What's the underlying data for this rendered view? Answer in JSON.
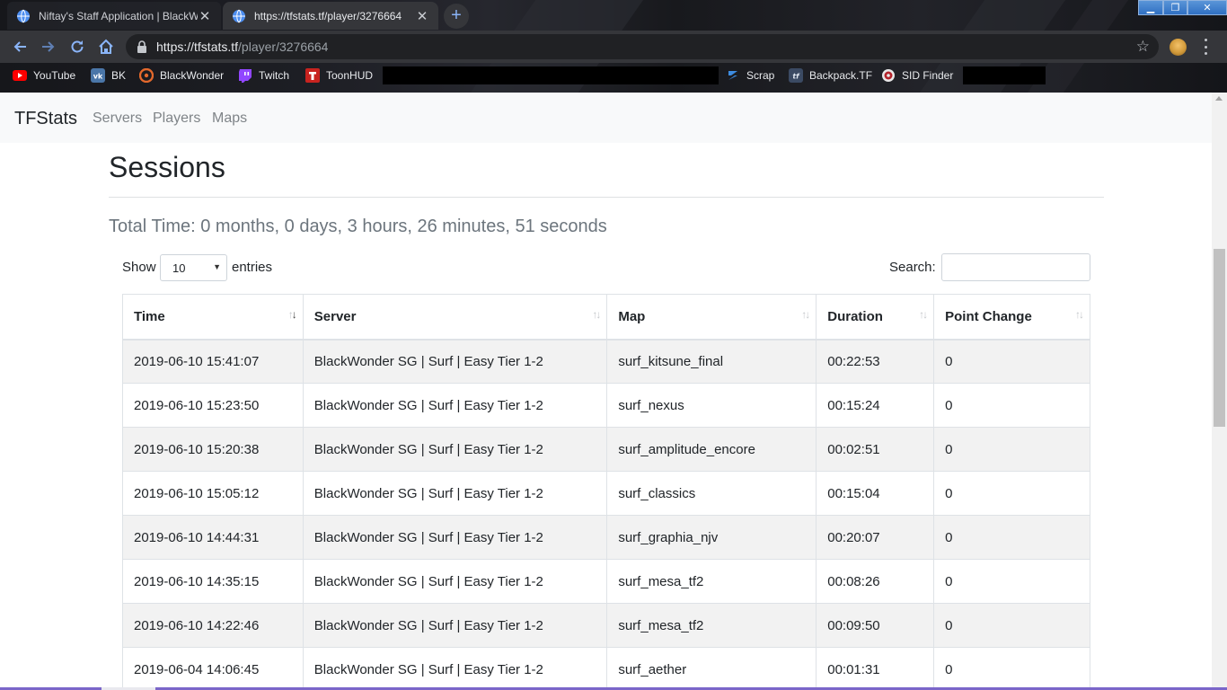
{
  "browser": {
    "tabs": [
      {
        "title": "Niftay's Staff Application | BlackWonder",
        "active": false
      },
      {
        "title": "https://tfstats.tf/player/3276664",
        "active": true
      }
    ],
    "new_tab_label": "+",
    "url_host": "https://tfstats.tf",
    "url_path": "/player/3276664",
    "window_controls": {
      "minimize": "▁",
      "maximize": "❐",
      "close": "✕"
    },
    "bookmarks": [
      {
        "label": "YouTube",
        "icon": "youtube-icon"
      },
      {
        "label": "BK",
        "icon": "vk-icon"
      },
      {
        "label": "BlackWonder",
        "icon": "blackwonder-icon"
      },
      {
        "label": "Twitch",
        "icon": "twitch-icon"
      },
      {
        "label": "ToonHUD",
        "icon": "toonhud-icon"
      },
      {
        "label": "Scrap",
        "icon": "scrap-icon"
      },
      {
        "label": "Backpack.TF",
        "icon": "backpack-tf-icon"
      },
      {
        "label": "SID Finder",
        "icon": "sid-finder-icon"
      }
    ]
  },
  "nav": {
    "brand": "TFStats",
    "links": [
      "Servers",
      "Players",
      "Maps"
    ]
  },
  "main": {
    "heading": "Sessions",
    "total_time": "Total Time: 0 months, 0 days, 3 hours, 26 minutes, 51 seconds",
    "length": {
      "show_label": "Show",
      "value": "10",
      "entries_label": "entries"
    },
    "search": {
      "label": "Search:",
      "value": ""
    }
  },
  "table": {
    "columns": [
      "Time",
      "Server",
      "Map",
      "Duration",
      "Point Change"
    ],
    "sorted_column": "Time",
    "rows": [
      [
        "2019-06-10 15:41:07",
        "BlackWonder SG | Surf | Easy Tier 1-2",
        "surf_kitsune_final",
        "00:22:53",
        "0"
      ],
      [
        "2019-06-10 15:23:50",
        "BlackWonder SG | Surf | Easy Tier 1-2",
        "surf_nexus",
        "00:15:24",
        "0"
      ],
      [
        "2019-06-10 15:20:38",
        "BlackWonder SG | Surf | Easy Tier 1-2",
        "surf_amplitude_encore",
        "00:02:51",
        "0"
      ],
      [
        "2019-06-10 15:05:12",
        "BlackWonder SG | Surf | Easy Tier 1-2",
        "surf_classics",
        "00:15:04",
        "0"
      ],
      [
        "2019-06-10 14:44:31",
        "BlackWonder SG | Surf | Easy Tier 1-2",
        "surf_graphia_njv",
        "00:20:07",
        "0"
      ],
      [
        "2019-06-10 14:35:15",
        "BlackWonder SG | Surf | Easy Tier 1-2",
        "surf_mesa_tf2",
        "00:08:26",
        "0"
      ],
      [
        "2019-06-10 14:22:46",
        "BlackWonder SG | Surf | Easy Tier 1-2",
        "surf_mesa_tf2",
        "00:09:50",
        "0"
      ],
      [
        "2019-06-04 14:06:45",
        "BlackWonder SG | Surf | Easy Tier 1-2",
        "surf_aether",
        "00:01:31",
        "0"
      ]
    ]
  },
  "colors": {
    "chrome_toolbar": "#35363a",
    "omnibox": "#202124",
    "navbar_bg": "#f8f9fa",
    "stripe": "#f2f2f2",
    "border": "#dee2e6",
    "tab_accent": "#8ab4f8"
  }
}
